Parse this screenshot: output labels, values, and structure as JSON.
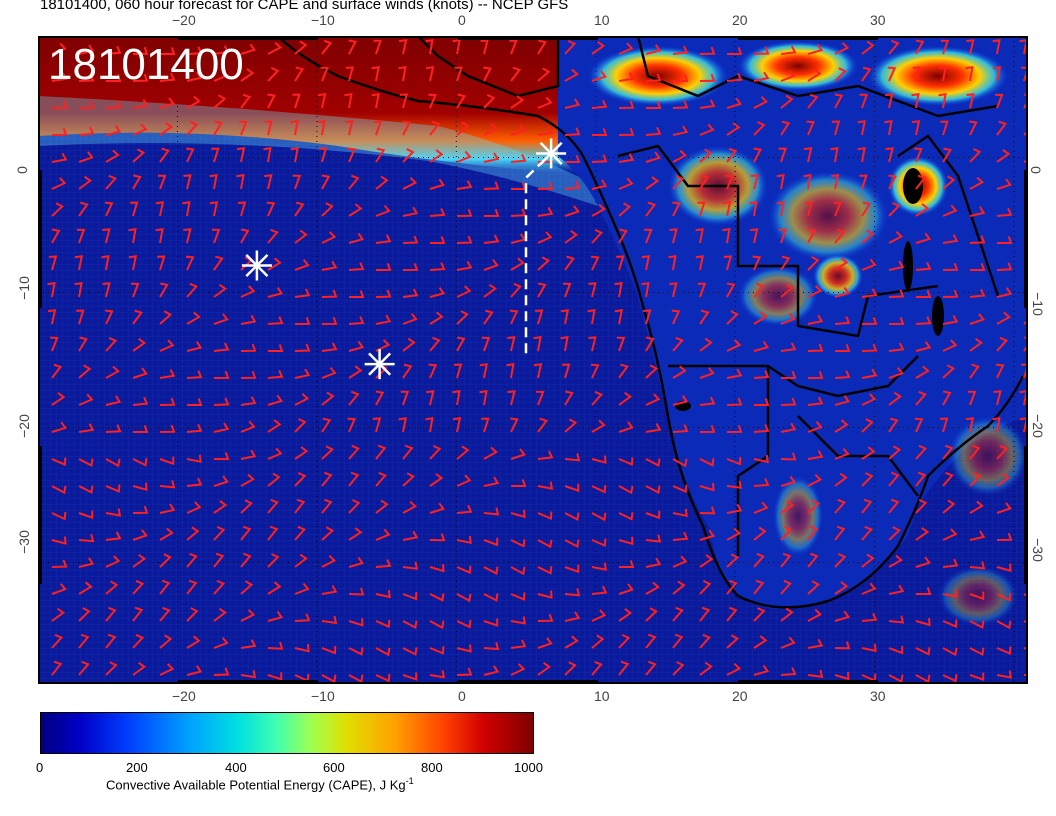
{
  "title": "18101400, 060 hour forecast for CAPE and surface winds (knots) -- NCEP GFS",
  "stamp": "18101400",
  "top_ticks": [
    "−20",
    "−10",
    "0",
    "10",
    "20",
    "30"
  ],
  "bottom_ticks": [
    "−20",
    "−10",
    "0",
    "10",
    "20",
    "30"
  ],
  "left_ticks": [
    "0",
    "−10",
    "−20",
    "−30"
  ],
  "right_ticks": [
    "0",
    "−10",
    "−20",
    "−30"
  ],
  "colorbar": {
    "labels": [
      "0",
      "200",
      "400",
      "600",
      "800",
      "1000"
    ],
    "title": "Convective Available Potential Energy (CAPE), J Kg",
    "title_sup": "-1"
  },
  "colors": {
    "ocean": "#0a1a9c",
    "barb": "#ff2020",
    "coast": "#000000",
    "marker": "#ffffff"
  },
  "map_extent": {
    "lon": [
      -30,
      41
    ],
    "lat": [
      -39,
      9
    ]
  },
  "markers": [
    {
      "lon": 6.8,
      "lat": 0.3
    },
    {
      "lon": -14.3,
      "lat": -8.0
    },
    {
      "lon": -5.5,
      "lat": -15.3
    }
  ],
  "track": {
    "lon": [
      5,
      5,
      6.8
    ],
    "lat": [
      -14.5,
      -1.5,
      0.3
    ]
  }
}
